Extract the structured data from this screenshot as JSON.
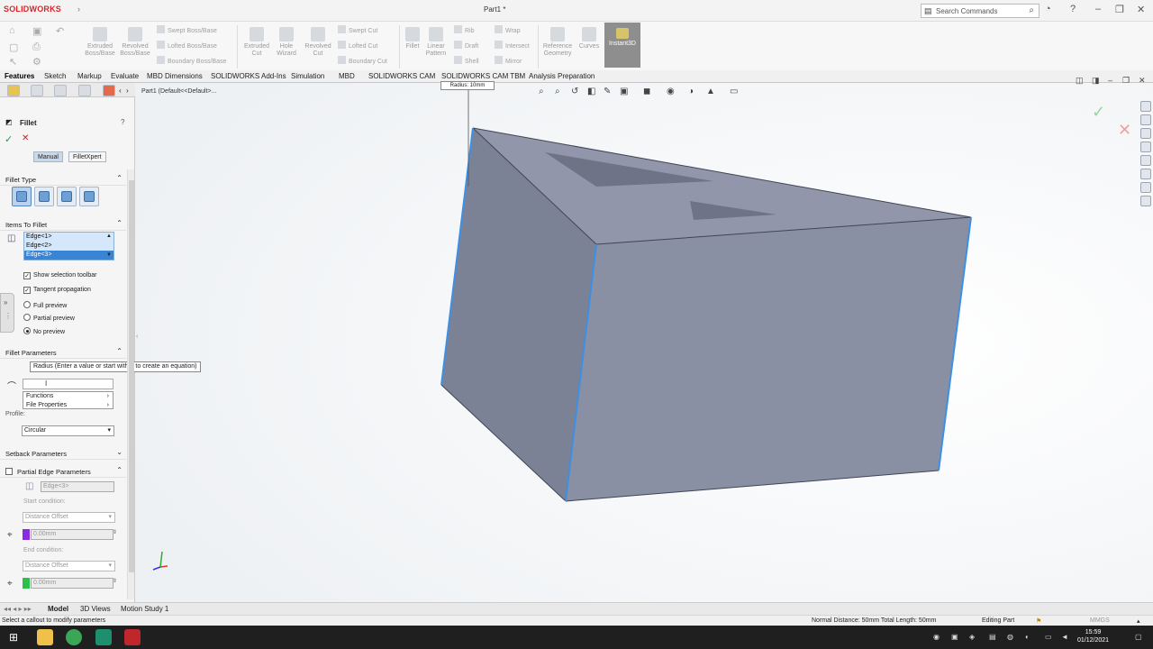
{
  "app": {
    "logo_text": "SOLIDWORKS",
    "document_title": "Part1 *",
    "search_placeholder": "Search Commands"
  },
  "commands": {
    "extruded_boss": "Extruded Boss/Base",
    "revolved_boss": "Revolved Boss/Base",
    "swept_boss": "Swept Boss/Base",
    "lofted_boss": "Lofted Boss/Base",
    "boundary_boss": "Boundary Boss/Base",
    "extruded_cut": "Extruded Cut",
    "hole_wizard": "Hole Wizard",
    "revolved_cut": "Revolved Cut",
    "swept_cut": "Swept Cut",
    "lofted_cut": "Lofted Cut",
    "boundary_cut": "Boundary Cut",
    "fillet": "Fillet",
    "linear_pattern": "Linear Pattern",
    "rib": "Rib",
    "draft": "Draft",
    "shell": "Shell",
    "wrap": "Wrap",
    "intersect": "Intersect",
    "mirror": "Mirror",
    "reference_geometry": "Reference Geometry",
    "curves": "Curves",
    "instant3d": "Instant3D"
  },
  "tabs": [
    "Features",
    "Sketch",
    "Markup",
    "Evaluate",
    "MBD Dimensions",
    "SOLIDWORKS Add-Ins",
    "Simulation",
    "MBD",
    "SOLIDWORKS CAM",
    "SOLIDWORKS CAM TBM",
    "Analysis Preparation"
  ],
  "panel": {
    "title": "Fillet",
    "mode_manual": "Manual",
    "mode_filletxpert": "FilletXpert",
    "fillet_type_header": "Fillet Type",
    "items_header": "Items To Fillet",
    "edges": [
      "Edge<1>",
      "Edge<2>",
      "Edge<3>"
    ],
    "show_selection_toolbar": "Show selection toolbar",
    "tangent_propagation": "Tangent propagation",
    "full_preview": "Full preview",
    "partial_preview": "Partial preview",
    "no_preview": "No preview",
    "fillet_params_header": "Fillet Parameters",
    "radius_tooltip": "Radius (Enter a value or start with = to create an equation)",
    "menu_functions": "Functions",
    "menu_file_properties": "File Properties",
    "profile_label": "Profile:",
    "profile_value": "Circular",
    "setback_header": "Setback Parameters",
    "partial_edge_header": "Partial Edge Parameters",
    "partial_edge_value": "Edge<3>",
    "start_condition_label": "Start condition:",
    "start_condition_value": "Distance Offset",
    "start_offset": "0.00mm",
    "end_condition_label": "End condition:",
    "end_condition_value": "Distance Offset",
    "end_offset": "0.00mm"
  },
  "viewport": {
    "tree_root": "Part1  (Default<<Default>...",
    "callout": "Radius: 10mm"
  },
  "bottom_tabs": [
    "Model",
    "3D Views",
    "Motion Study 1"
  ],
  "status": {
    "hint": "Select a callout to modify parameters",
    "measure": "Normal Distance: 50mm  Total Length: 50mm",
    "mode": "Editing Part",
    "units": "MMGS"
  },
  "clock": {
    "time": "15:59",
    "date": "01/12/2021"
  },
  "colors": {
    "model_face": "#8a90a3",
    "model_top": "#9196aa",
    "selected_edge": "#3d8fe6",
    "brand": "#d9252a"
  }
}
